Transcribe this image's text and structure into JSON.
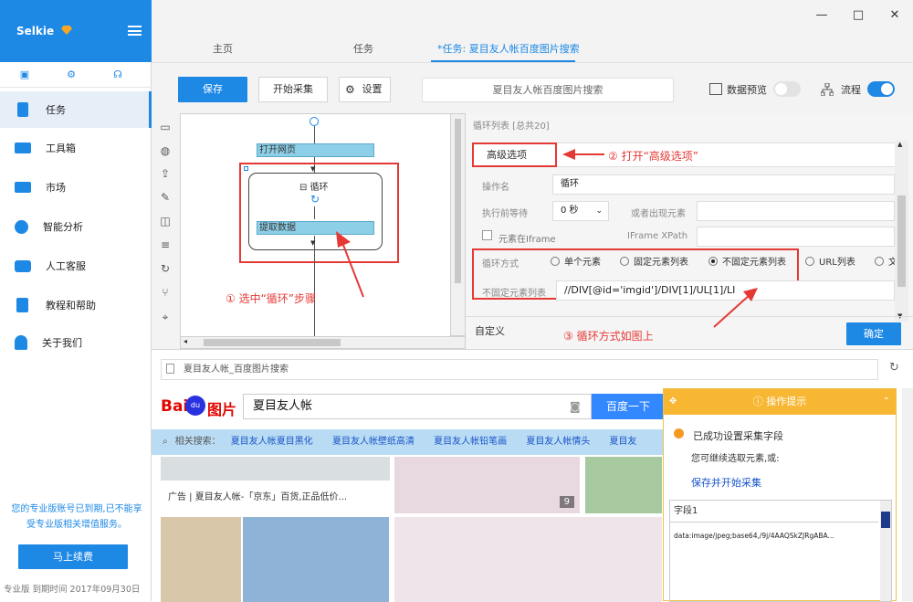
{
  "app": {
    "brand": "Selkie"
  },
  "sidebar": {
    "items": [
      {
        "label": "任务",
        "active": true,
        "icon": "task-icon"
      },
      {
        "label": "工具箱",
        "icon": "toolbox-icon"
      },
      {
        "label": "市场",
        "icon": "market-icon"
      },
      {
        "label": "智能分析",
        "icon": "pie-chart-icon"
      },
      {
        "label": "人工客服",
        "icon": "chat-icon"
      },
      {
        "label": "教程和帮助",
        "icon": "book-icon"
      },
      {
        "label": "关于我们",
        "icon": "user-icon"
      }
    ],
    "notice": "您的专业版账号已到期,已不能享受专业版相关增值服务。",
    "renew_label": "马上续费",
    "footer": "专业版  到期时间  2017年09月30日"
  },
  "tabs": [
    {
      "label": "主页"
    },
    {
      "label": "任务"
    },
    {
      "label": "*任务: 夏目友人帐百度图片搜索",
      "active": true
    }
  ],
  "toolbar": {
    "save_label": "保存",
    "start_label": "开始采集",
    "settings_label": "设置",
    "task_title": "夏目友人帐百度图片搜索",
    "preview_label": "数据预览",
    "flow_label": "流程"
  },
  "flow": {
    "step_open": "打开网页",
    "loop_label": "循环",
    "step_extract": "提取数据"
  },
  "annotations": {
    "a1": "① 选中“循环”步骤",
    "a2": "② 打开“高级选项”",
    "a3": "③ 循环方式如图上"
  },
  "panel": {
    "header": "循环列表 [总共20]",
    "advanced_label": "高级选项",
    "op_name_label": "操作名",
    "op_name_value": "循环",
    "wait_label": "执行前等待",
    "wait_value": "0 秒",
    "or_appear_label": "或者出现元素",
    "iframe_label": "元素在Iframe",
    "iframe_xpath_label": "IFrame XPath",
    "loop_mode_label": "循环方式",
    "options": [
      "单个元素",
      "固定元素列表",
      "不固定元素列表",
      "URL列表",
      "文"
    ],
    "selected_option": "不固定元素列表",
    "list_label": "不固定元素列表",
    "list_value": "//DIV[@id='imgid']/DIV[1]/UL[1]/LI",
    "custom_label": "自定义",
    "ok_label": "确定"
  },
  "browser": {
    "url": "夏目友人帐_百度图片搜索",
    "logo_text": "Bai",
    "logo_du": "du",
    "logo_img": "图片",
    "search_value": "夏目友人帐",
    "search_button": "百度一下",
    "related_label": "相关搜索：",
    "related": [
      "夏目友人帐夏目黑化",
      "夏目友人帐壁纸高清",
      "夏目友人帐铅笔画",
      "夏目友人帐情头",
      "夏目友"
    ],
    "ad_text": "广告 | 夏目友人帐-「京东」百货,正品低价...",
    "img_count": "9"
  },
  "tip": {
    "title": "操作提示",
    "line1": "已成功设置采集字段",
    "line2": "您可继续选取元素,或:",
    "link": "保存并开始采集",
    "field": "字段1",
    "value": "data:image/jpeg;base64,/9j/4AAQSkZJRgABA..."
  }
}
